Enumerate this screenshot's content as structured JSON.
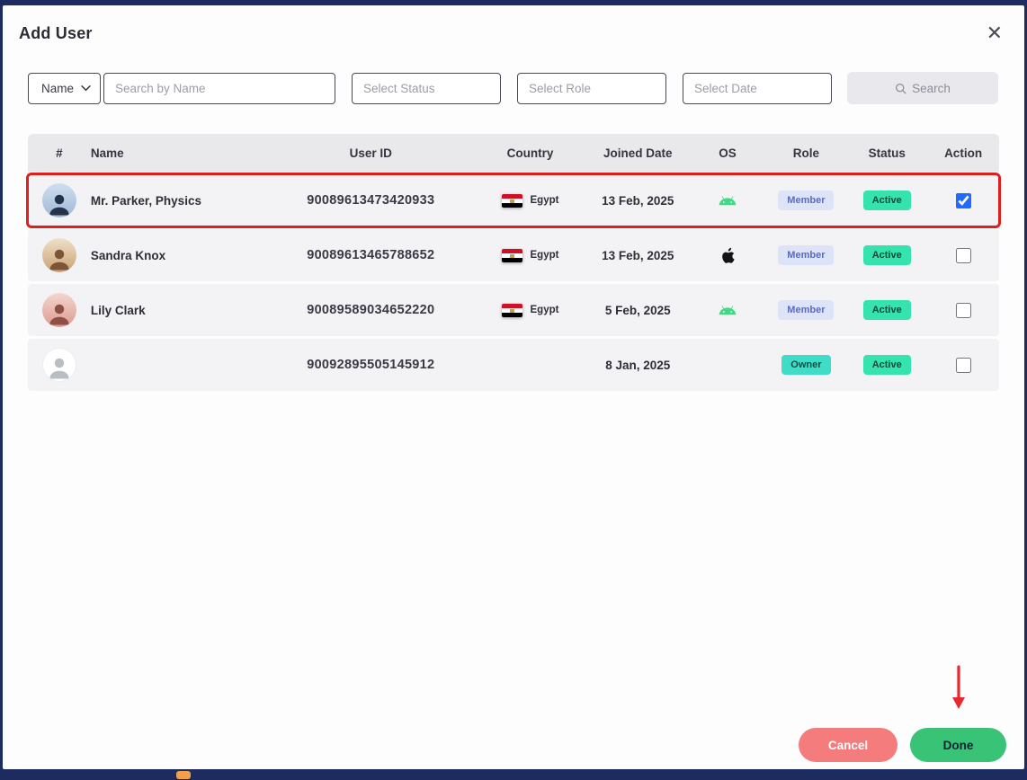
{
  "modal": {
    "title": "Add User",
    "close_icon": "✕"
  },
  "filters": {
    "name_dropdown_label": "Name",
    "search_placeholder": "Search by Name",
    "status_placeholder": "Select Status",
    "role_placeholder": "Select Role",
    "date_placeholder": "Select Date",
    "search_button_label": "Search"
  },
  "table": {
    "headers": [
      "#",
      "Name",
      "User ID",
      "Country",
      "Joined Date",
      "OS",
      "Role",
      "Status",
      "Action"
    ],
    "rows": [
      {
        "name": "Mr. Parker, Physics",
        "user_id": "90089613473420933",
        "country": "Egypt",
        "joined": "13 Feb, 2025",
        "os": "android",
        "role": "Member",
        "status": "Active",
        "checked": true,
        "highlighted": true
      },
      {
        "name": "Sandra Knox",
        "user_id": "90089613465788652",
        "country": "Egypt",
        "joined": "13 Feb, 2025",
        "os": "apple",
        "role": "Member",
        "status": "Active",
        "checked": false,
        "highlighted": false
      },
      {
        "name": "Lily Clark",
        "user_id": "90089589034652220",
        "country": "Egypt",
        "joined": "5 Feb, 2025",
        "os": "android",
        "role": "Member",
        "status": "Active",
        "checked": false,
        "highlighted": false
      },
      {
        "name": "",
        "user_id": "90092895505145912",
        "country": "",
        "joined": "8 Jan, 2025",
        "os": "",
        "role": "Owner",
        "status": "Active",
        "checked": false,
        "highlighted": false
      }
    ]
  },
  "footer": {
    "cancel_label": "Cancel",
    "done_label": "Done"
  },
  "colors": {
    "highlight_border": "#e01e1e",
    "active_badge": "#35e3ae",
    "member_badge_bg": "#dee4f8",
    "owner_badge_bg": "#3fdcc8",
    "cancel_button": "#f47c7c",
    "done_button": "#38c376",
    "checkbox_checked": "#1f6bff",
    "android_green": "#3ddc84",
    "frame": "#1e2b5e"
  }
}
